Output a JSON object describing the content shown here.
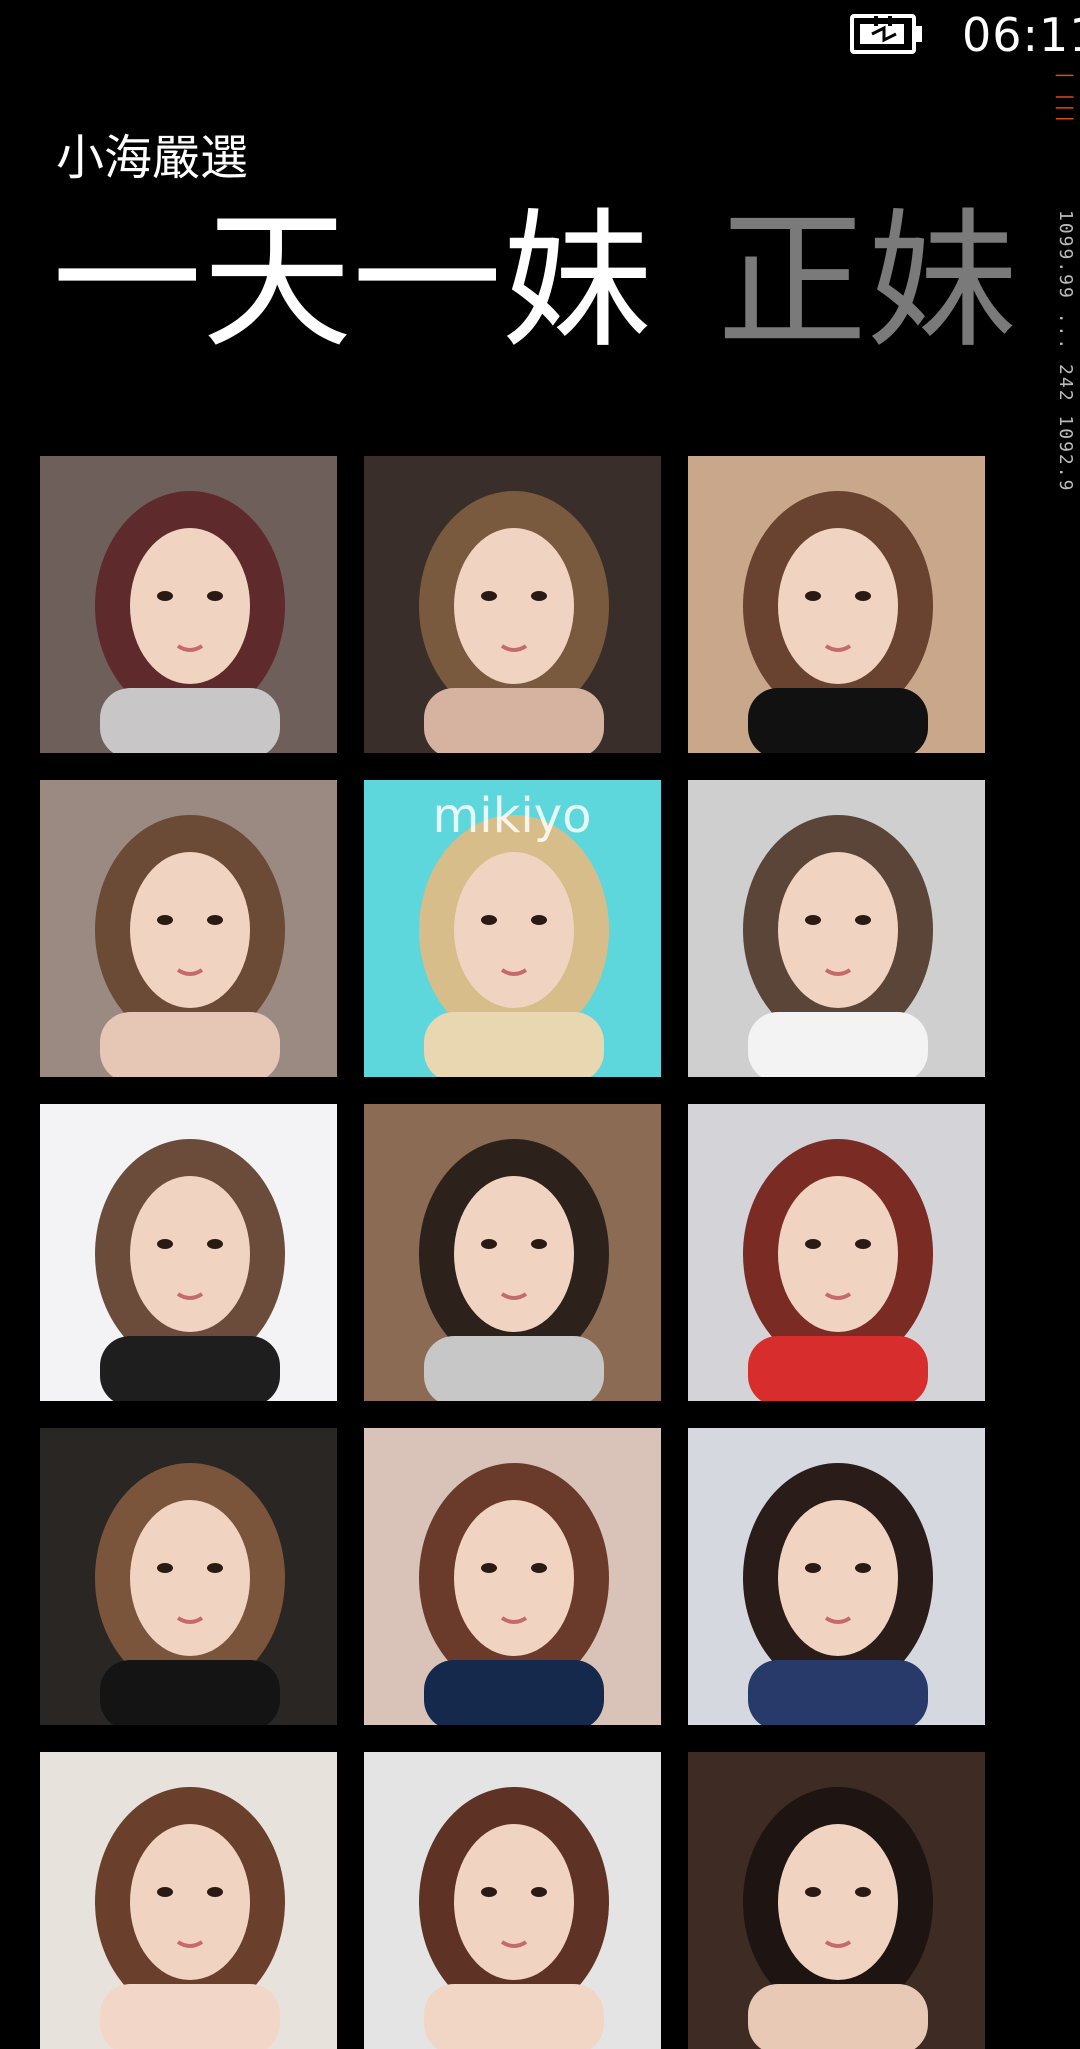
{
  "status_bar": {
    "time": "06:11",
    "battery_icon": "battery-charging-icon"
  },
  "debug_rail": {
    "accent_text": "| |||",
    "text": "1099.99 ...  242 1092.9"
  },
  "header": {
    "app_title": "小海嚴選",
    "pivot_tabs": [
      {
        "label": "一天一妹",
        "active": true
      },
      {
        "label": "正妹",
        "active": false
      }
    ]
  },
  "grid": {
    "columns": 3,
    "photos": [
      {
        "name": "photo-1",
        "caption": "",
        "bg": "#6e5f5a",
        "accent": "#c9c6c8",
        "hair": "#5e2a2c"
      },
      {
        "name": "photo-2",
        "caption": "",
        "bg": "#3a2e2a",
        "accent": "#d6b3a1",
        "hair": "#7a5a3e"
      },
      {
        "name": "photo-3",
        "caption": "",
        "bg": "#c8a78a",
        "accent": "#111111",
        "hair": "#6a4330"
      },
      {
        "name": "photo-4",
        "caption": "",
        "bg": "#9b8a82",
        "accent": "#e6c7b5",
        "hair": "#6b4a36"
      },
      {
        "name": "photo-5",
        "caption": "mikiyo",
        "bg": "#5dd7dc",
        "accent": "#e8d7b0",
        "hair": "#d7bd8a"
      },
      {
        "name": "photo-6",
        "caption": "",
        "bg": "#cfcfcf",
        "accent": "#f3f3f3",
        "hair": "#5b4538"
      },
      {
        "name": "photo-7",
        "caption": "",
        "bg": "#f3f3f5",
        "accent": "#1e1e1e",
        "hair": "#6b4c3a"
      },
      {
        "name": "photo-8",
        "caption": "",
        "bg": "#8b6b54",
        "accent": "#c7c7c7",
        "hair": "#2c211b"
      },
      {
        "name": "photo-9",
        "caption": "",
        "bg": "#d4d4d8",
        "accent": "#d82d2d",
        "hair": "#7a2b24"
      },
      {
        "name": "photo-10",
        "caption": "",
        "bg": "#2a2624",
        "accent": "#141414",
        "hair": "#7a553c"
      },
      {
        "name": "photo-11",
        "caption": "",
        "bg": "#d9c3b9",
        "accent": "#15294d",
        "hair": "#6a3a2a"
      },
      {
        "name": "photo-12",
        "caption": "",
        "bg": "#d6d8e0",
        "accent": "#283a6a",
        "hair": "#2a1c18"
      },
      {
        "name": "photo-13",
        "caption": "",
        "bg": "#e8e2dc",
        "accent": "#f2d7c8",
        "hair": "#6a3f2c"
      },
      {
        "name": "photo-14",
        "caption": "",
        "bg": "#e4e4e4",
        "accent": "#f1d6c6",
        "hair": "#5e3225"
      },
      {
        "name": "photo-15",
        "caption": "",
        "bg": "#3d2b24",
        "accent": "#e8c9b5",
        "hair": "#1e1412"
      }
    ]
  }
}
